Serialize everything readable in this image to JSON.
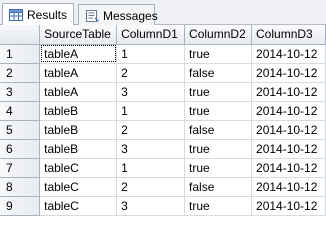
{
  "tabs": {
    "results_label": "Results",
    "messages_label": "Messages"
  },
  "grid": {
    "columns": [
      "SourceTable",
      "ColumnD1",
      "ColumnD2",
      "ColumnD3"
    ],
    "rows": [
      {
        "num": "1",
        "cells": [
          "tableA",
          "1",
          "true",
          "2014-10-12"
        ]
      },
      {
        "num": "2",
        "cells": [
          "tableA",
          "2",
          "false",
          "2014-10-12"
        ]
      },
      {
        "num": "3",
        "cells": [
          "tableA",
          "3",
          "true",
          "2014-10-12"
        ]
      },
      {
        "num": "4",
        "cells": [
          "tableB",
          "1",
          "true",
          "2014-10-12"
        ]
      },
      {
        "num": "5",
        "cells": [
          "tableB",
          "2",
          "false",
          "2014-10-12"
        ]
      },
      {
        "num": "6",
        "cells": [
          "tableB",
          "3",
          "true",
          "2014-10-12"
        ]
      },
      {
        "num": "7",
        "cells": [
          "tableC",
          "1",
          "true",
          "2014-10-12"
        ]
      },
      {
        "num": "8",
        "cells": [
          "tableC",
          "2",
          "false",
          "2014-10-12"
        ]
      },
      {
        "num": "9",
        "cells": [
          "tableC",
          "3",
          "true",
          "2014-10-12"
        ]
      }
    ]
  },
  "icons": {
    "results": "grid-icon",
    "messages": "messages-icon"
  }
}
